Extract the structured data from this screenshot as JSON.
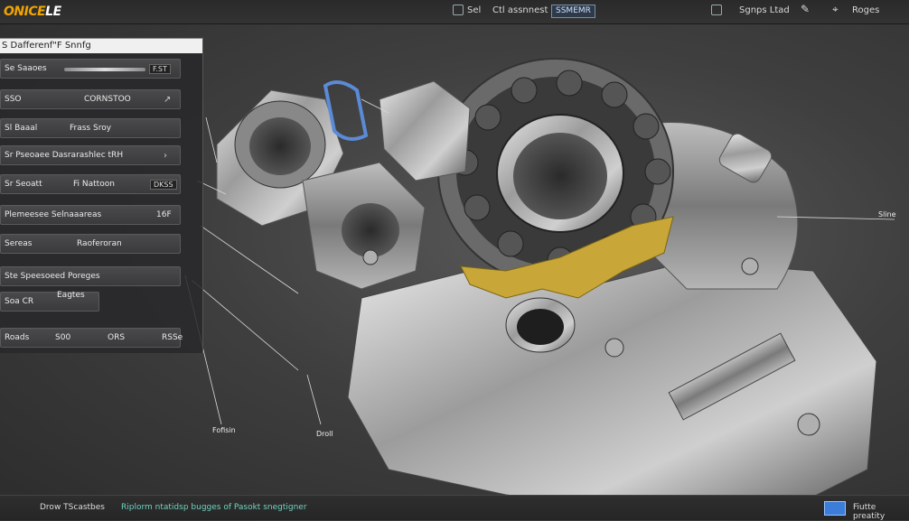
{
  "app": {
    "logo_text": "ONICE",
    "logo_suffix": "LE"
  },
  "topbar": {
    "tab1": "Sel",
    "tab2": "Ctl assnnest",
    "badge": "SSMEMR",
    "right1": "Sgnps Ltad",
    "right2": "Roges"
  },
  "panel": {
    "title": "S  Dafferenf\"F Snnfg",
    "rows": [
      {
        "label": "Se Saaoes",
        "value": "",
        "chip": "F.ST"
      },
      {
        "label": "SSO",
        "value": "CORNSTOO",
        "chip": ""
      },
      {
        "label": "Sl   Baaal",
        "value": "Frass Sroy",
        "chip": ""
      },
      {
        "label": "Sr Pseoaee Dasrarashlec tRH",
        "value": "",
        "chip": ""
      },
      {
        "label": "Sr Seoatt",
        "value": "Fi Nattoon",
        "chip": "DKSS"
      },
      {
        "label": "Plemeesee Selnaaareas",
        "value": "",
        "chip": "16F"
      },
      {
        "label": "Sereas",
        "value": "Raoferoran",
        "chip": ""
      },
      {
        "label": "Ste Speesoeed Poreges",
        "value": "",
        "chip": ""
      },
      {
        "label": "Soa CR",
        "value": "Eagtes",
        "chip": ""
      },
      {
        "label": "Roads",
        "value": "S00",
        "value2": "ORS",
        "value3": "RSSe"
      }
    ]
  },
  "callouts": {
    "right": "Sline",
    "bottom1": "Fofisin",
    "bottom2": "Droll"
  },
  "bottombar": {
    "left": "Drow TScastbes",
    "status": "Riplorm ntatidsp bugges of Pasokt snegtigner",
    "right": "Fiutte preatity"
  },
  "colors": {
    "accent": "#f0a400",
    "status": "#6fd3c0",
    "button": "#3b7dd8"
  }
}
